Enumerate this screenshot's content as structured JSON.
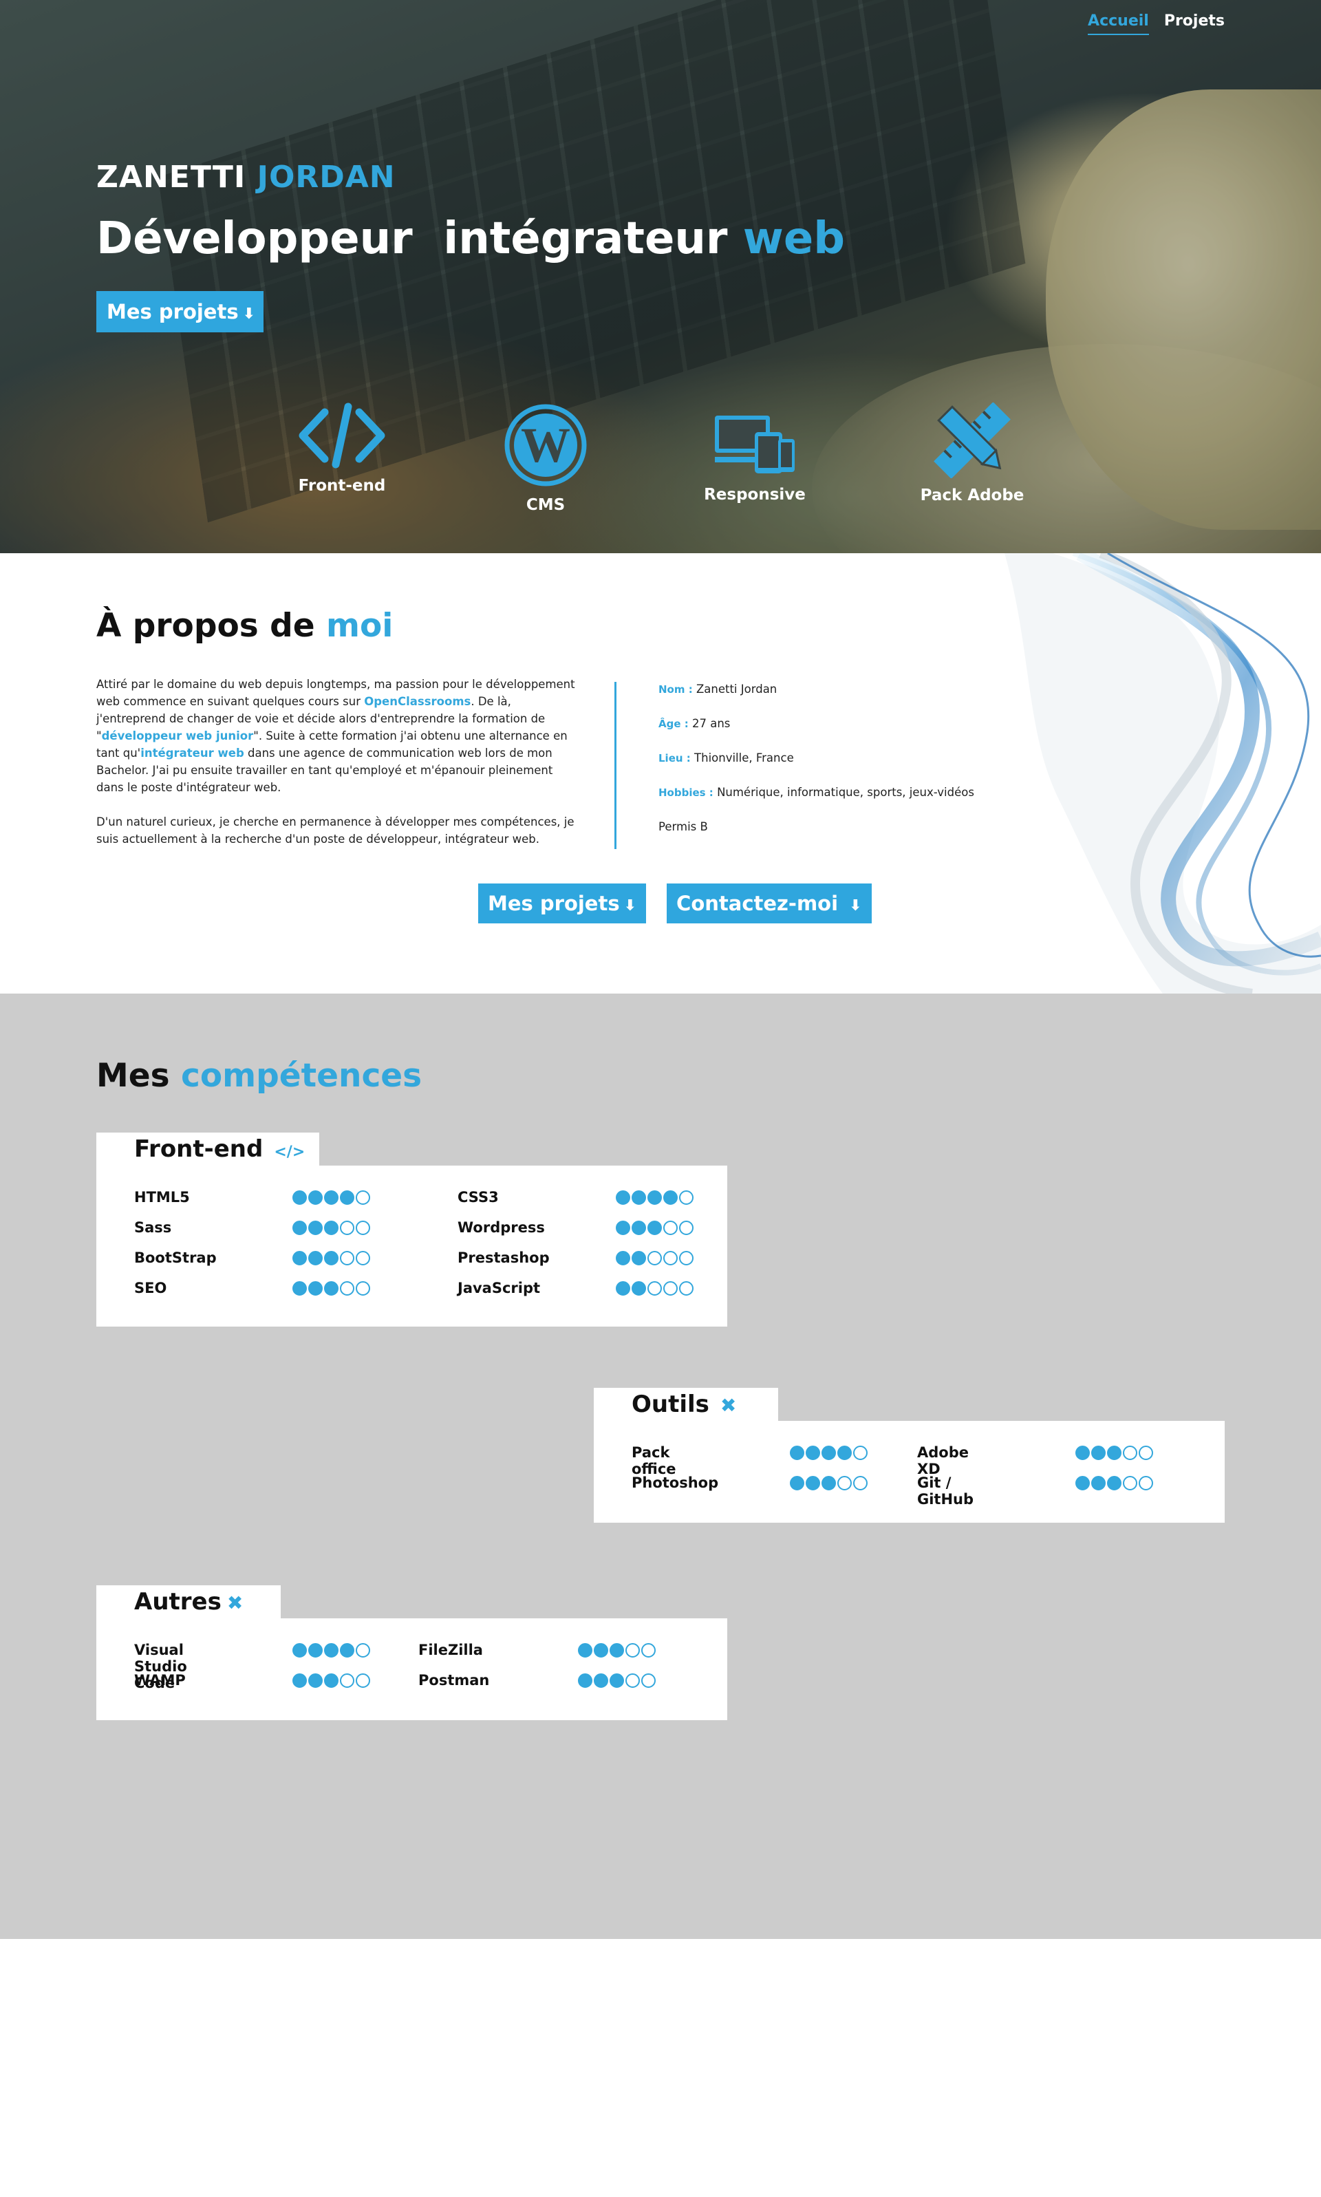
{
  "nav": {
    "items": [
      {
        "label": "Accueil"
      },
      {
        "label": "Projets"
      }
    ]
  },
  "hero": {
    "name_first": "ZANETTI",
    "name_last": "JORDAN",
    "title_main": "Développeur  intégrateur",
    "title_accent": "web",
    "button": "Mes projets",
    "icons": [
      {
        "icon": "code-icon",
        "label": "Front-end"
      },
      {
        "icon": "wordpress-icon",
        "label": "CMS"
      },
      {
        "icon": "devices-icon",
        "label": "Responsive"
      },
      {
        "icon": "pencil-ruler-icon",
        "label": "Pack Adobe"
      }
    ]
  },
  "about": {
    "title_main": "À propos de",
    "title_accent": "moi",
    "p1_a": "Attiré par le domaine du web depuis longtemps, ma passion pour le développement web commence en suivant quelques cours sur ",
    "p1_link1": "OpenClassrooms",
    "p1_b": ". De là, j'entreprend de changer de voie et décide alors d'entreprendre la formation de \"",
    "p1_link2": "développeur web junior",
    "p1_c": "\". Suite à cette formation j'ai obtenu une alternance en tant qu'",
    "p1_link3": "intégrateur web",
    "p1_d": " dans une agence de communication web lors de mon Bachelor. J'ai pu ensuite travailler en tant qu'employé et m'épanouir pleinement dans le poste d'intégrateur web.",
    "p2": "D'un naturel curieux, je cherche en permanence à développer mes compétences, je suis actuellement à la recherche d'un poste de développeur, intégrateur web.",
    "facts": [
      {
        "key": "Nom :",
        "value": "Zanetti Jordan"
      },
      {
        "key": "Âge :",
        "value": "27 ans"
      },
      {
        "key": "Lieu :",
        "value": "Thionville, France"
      },
      {
        "key": "Hobbies :",
        "value": "Numérique, informatique, sports, jeux-vidéos"
      },
      {
        "key": "",
        "value": "Permis B"
      }
    ],
    "btn_projects": "Mes projets",
    "btn_contact": "Contactez-moi"
  },
  "skills": {
    "title_main": "Mes",
    "title_accent": "compétences",
    "groups": [
      {
        "name": "Front-end",
        "icon": "code-icon",
        "items": [
          {
            "name": "HTML5",
            "level": 4
          },
          {
            "name": "CSS3",
            "level": 4
          },
          {
            "name": "Sass",
            "level": 3
          },
          {
            "name": "Wordpress",
            "level": 3
          },
          {
            "name": "BootStrap",
            "level": 3
          },
          {
            "name": "Prestashop",
            "level": 2
          },
          {
            "name": "SEO",
            "level": 3
          },
          {
            "name": "JavaScript",
            "level": 2
          }
        ]
      },
      {
        "name": "Outils",
        "icon": "tools-icon",
        "items": [
          {
            "name": "Pack office",
            "level": 4
          },
          {
            "name": "Adobe XD",
            "level": 3
          },
          {
            "name": "Photoshop",
            "level": 3
          },
          {
            "name": "Git / GitHub",
            "level": 3
          }
        ]
      },
      {
        "name": "Autres",
        "icon": "tools-icon",
        "items": [
          {
            "name": "Visual Studio Code",
            "level": 4
          },
          {
            "name": "FileZilla",
            "level": 3
          },
          {
            "name": "WAMP",
            "level": 3
          },
          {
            "name": "Postman",
            "level": 3
          }
        ]
      }
    ],
    "max_level": 5
  },
  "colors": {
    "accent": "#33a7dc",
    "skills_bg": "#cccccc"
  }
}
